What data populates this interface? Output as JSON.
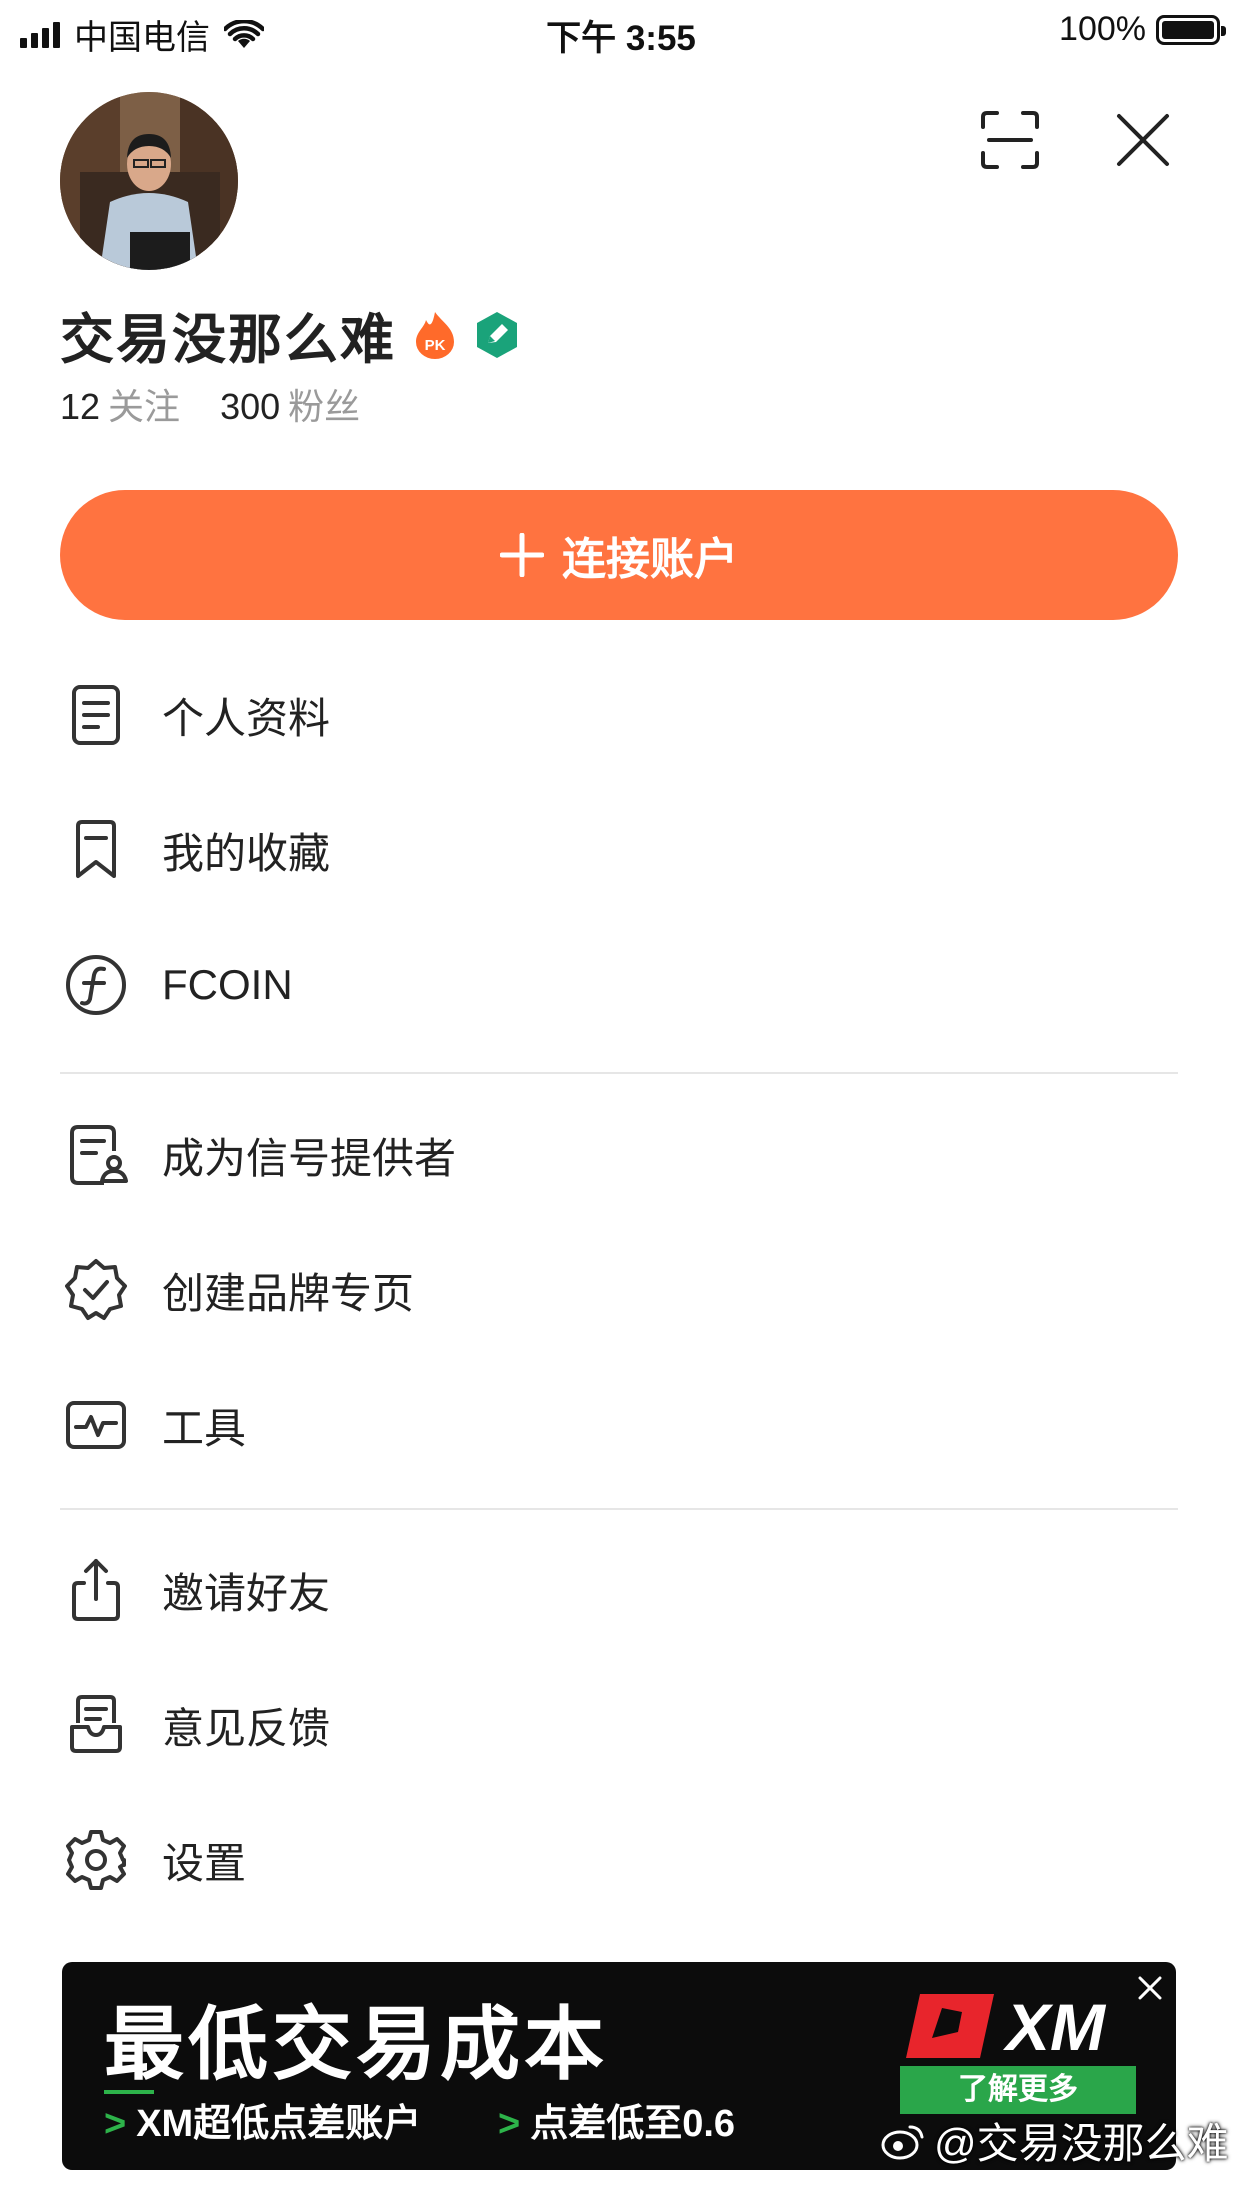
{
  "status_bar": {
    "carrier": "中国电信",
    "time": "下午 3:55",
    "battery": "100%"
  },
  "profile": {
    "name": "交易没那么难",
    "badge_pk": "PK",
    "following_count": "12",
    "following_label": "关注",
    "followers_count": "300",
    "followers_label": "粉丝"
  },
  "connect_button": {
    "label": "连接账户"
  },
  "menu": {
    "group1": [
      {
        "label": "个人资料",
        "icon": "document-icon"
      },
      {
        "label": "我的收藏",
        "icon": "bookmark-icon"
      },
      {
        "label": "FCOIN",
        "icon": "fcoin-icon"
      }
    ],
    "group2": [
      {
        "label": "成为信号提供者",
        "icon": "signal-provider-icon"
      },
      {
        "label": "创建品牌专页",
        "icon": "verified-badge-icon"
      },
      {
        "label": "工具",
        "icon": "pulse-chart-icon"
      }
    ],
    "group3": [
      {
        "label": "邀请好友",
        "icon": "share-icon"
      },
      {
        "label": "意见反馈",
        "icon": "feedback-icon"
      },
      {
        "label": "设置",
        "icon": "gear-icon"
      }
    ]
  },
  "ad": {
    "title": "最低交易成本",
    "sub1": "XM超低点差账户",
    "sub2": "点差低至0.6",
    "cta": "了解更多",
    "brand": "XM"
  },
  "watermark": "@交易没那么难",
  "colors": {
    "accent": "#ff7340",
    "ad_green": "#2aa64a",
    "verify_teal": "#1aa37a"
  }
}
